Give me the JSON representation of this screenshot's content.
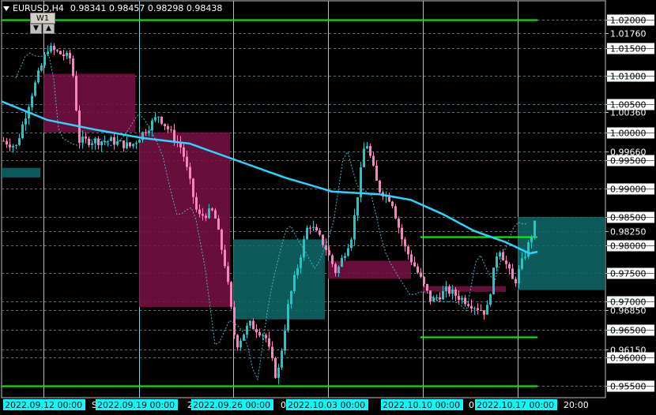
{
  "header": {
    "symbol": "EURUSD,H4",
    "quote": "0.98341 0.98457 0.98298 0.98438",
    "timeframe": "W1",
    "arrow_down": "▼",
    "arrow_up": "▲"
  },
  "colors": {
    "background": "#000000",
    "grid": "#5f6f74",
    "vline": "#7fd4e0",
    "bull_candle": "#1fc8c8",
    "bear_candle": "#ff80c0",
    "ma_line": "#29d6ff",
    "green_level": "#00ff00",
    "box_bear": "#7a1044",
    "box_bull": "#0f6a6a",
    "price_tag_bg": "#ffffff"
  },
  "price_axis": {
    "min": 0.9535,
    "max": 1.0218,
    "labels": [
      {
        "v": 1.02,
        "t": "1.02000",
        "tag": true
      },
      {
        "v": 1.0176,
        "t": "1.01760"
      },
      {
        "v": 1.015,
        "t": "1.01500",
        "tag": true
      },
      {
        "v": 1.01,
        "t": "1.01000",
        "tag": true
      },
      {
        "v": 1.005,
        "t": "1.00500",
        "tag": true
      },
      {
        "v": 1.0036,
        "t": "1.00360"
      },
      {
        "v": 1.0,
        "t": "1.00000",
        "tag": true
      },
      {
        "v": 0.9966,
        "t": "0.99660"
      },
      {
        "v": 0.995,
        "t": "0.99500",
        "tag": true
      },
      {
        "v": 0.99,
        "t": "0.99000",
        "tag": true
      },
      {
        "v": 0.985,
        "t": "0.98500",
        "tag": true
      },
      {
        "v": 0.9825,
        "t": "0.98250"
      },
      {
        "v": 0.98,
        "t": "0.98000",
        "tag": true
      },
      {
        "v": 0.975,
        "t": "0.97500",
        "tag": true
      },
      {
        "v": 0.97,
        "t": "0.97000",
        "tag": true
      },
      {
        "v": 0.9685,
        "t": "0.96850"
      },
      {
        "v": 0.965,
        "t": "0.96500",
        "tag": true
      },
      {
        "v": 0.9615,
        "t": "0.96150"
      },
      {
        "v": 0.96,
        "t": "0.96000",
        "tag": true
      },
      {
        "v": 0.955,
        "t": "0.95500",
        "tag": true
      }
    ]
  },
  "time_axis": {
    "labels": [
      {
        "t": "2022.09.12 00:00",
        "tag": true
      },
      {
        "t": "S"
      },
      {
        "t": "2022.09.19 00:00",
        "tag": true
      },
      {
        "t": "2"
      },
      {
        "t": "2022.09.26 00:00",
        "tag": true
      },
      {
        "t": "0"
      },
      {
        "t": "2022.10.03 00:00",
        "tag": true
      },
      {
        "t": "2022.10.10 00:00",
        "tag": true
      },
      {
        "t": "0"
      },
      {
        "t": "2022.10.17 00:00",
        "tag": true
      },
      {
        "t": "20:00"
      }
    ]
  }
}
